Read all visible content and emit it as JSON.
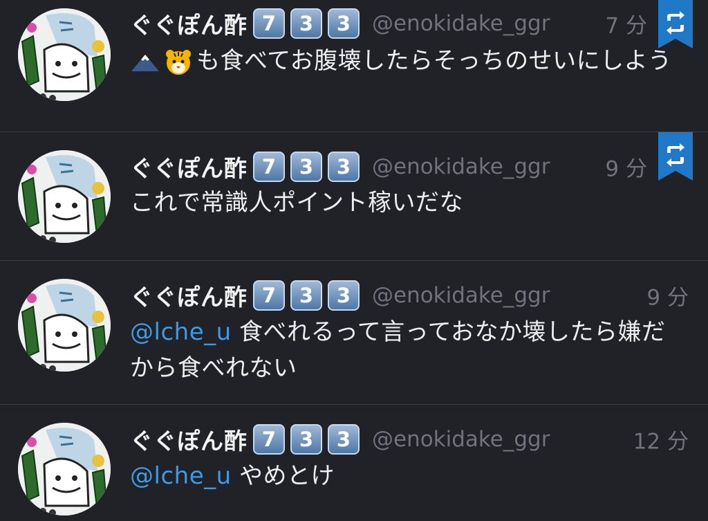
{
  "colors": {
    "background": "#202227",
    "divider": "#3a3d44",
    "name": "#f2f2f2",
    "meta": "#6f737b",
    "text": "#eceef0",
    "mention": "#3d9ae3",
    "retweet_badge": "#1f78c8"
  },
  "tweets": [
    {
      "name": "ぐぐぽん酢",
      "badges": [
        "7",
        "3",
        "3"
      ],
      "handle": "@enokidake_ggr",
      "time": "7 分",
      "mention": "",
      "text": "も食べてお腹壊したらそっちのせいにしよう",
      "emoji": [
        "mountain-icon",
        "tiger-icon"
      ],
      "retweeted": true
    },
    {
      "name": "ぐぐぽん酢",
      "badges": [
        "7",
        "3",
        "3"
      ],
      "handle": "@enokidake_ggr",
      "time": "9 分",
      "mention": "",
      "text": "これで常識人ポイント稼いだな",
      "retweeted": true
    },
    {
      "name": "ぐぐぽん酢",
      "badges": [
        "7",
        "3",
        "3"
      ],
      "handle": "@enokidake_ggr",
      "time": "9 分",
      "mention": "@lche_u",
      "text": " 食べれるって言っておなか壊したら嫌だから食べれない",
      "retweeted": false
    },
    {
      "name": "ぐぐぽん酢",
      "badges": [
        "7",
        "3",
        "3"
      ],
      "handle": "@enokidake_ggr",
      "time": "12 分",
      "mention": "@lche_u",
      "text": " やめとけ",
      "retweeted": false
    }
  ]
}
